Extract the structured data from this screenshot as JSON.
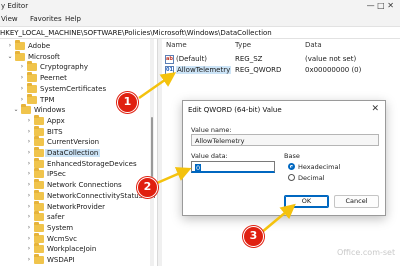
{
  "window": {
    "title": "y Editor",
    "controls": "—  □  ✕"
  },
  "menu": {
    "items": [
      "View",
      "Favorites",
      "Help"
    ]
  },
  "address": {
    "path": "HKEY_LOCAL_MACHINE\\SOFTWARE\\Policies\\Microsoft\\Windows\\DataCollection"
  },
  "tree": {
    "items": [
      {
        "label": "Adobe",
        "expanded": false,
        "selected": false
      },
      {
        "label": "Microsoft",
        "expanded": true,
        "selected": false
      },
      {
        "label": "Cryptography",
        "expanded": false,
        "selected": false
      },
      {
        "label": "Peernet",
        "expanded": false,
        "selected": false
      },
      {
        "label": "SystemCertificates",
        "expanded": false,
        "selected": false
      },
      {
        "label": "TPM",
        "expanded": false,
        "selected": false
      },
      {
        "label": "Windows",
        "expanded": true,
        "selected": false
      },
      {
        "label": "Appx",
        "expanded": false,
        "selected": false
      },
      {
        "label": "BITS",
        "expanded": false,
        "selected": false
      },
      {
        "label": "CurrentVersion",
        "expanded": false,
        "selected": false
      },
      {
        "label": "DataCollection",
        "expanded": false,
        "selected": true
      },
      {
        "label": "EnhancedStorageDevices",
        "expanded": false,
        "selected": false
      },
      {
        "label": "IPSec",
        "expanded": false,
        "selected": false
      },
      {
        "label": "Network Connections",
        "expanded": false,
        "selected": false
      },
      {
        "label": "NetworkConnectivityStatusIndi",
        "expanded": false,
        "selected": false
      },
      {
        "label": "NetworkProvider",
        "expanded": false,
        "selected": false
      },
      {
        "label": "safer",
        "expanded": false,
        "selected": false
      },
      {
        "label": "System",
        "expanded": false,
        "selected": false
      },
      {
        "label": "WcmSvc",
        "expanded": false,
        "selected": false
      },
      {
        "label": "WorkplaceJoin",
        "expanded": false,
        "selected": false
      },
      {
        "label": "WSDAPI",
        "expanded": false,
        "selected": false
      }
    ]
  },
  "values": {
    "headers": {
      "name": "Name",
      "type": "Type",
      "data": "Data"
    },
    "rows": [
      {
        "icon": "string-value-icon",
        "icon_text": "ab",
        "name": "(Default)",
        "type": "REG_SZ",
        "data": "(value not set)"
      },
      {
        "icon": "binary-value-icon",
        "icon_text": "01",
        "name": "AllowTelemetry",
        "type": "REG_QWORD",
        "data": "0x00000000 (0)"
      }
    ]
  },
  "dialog": {
    "title": "Edit QWORD (64-bit) Value",
    "close": "✕",
    "value_name_label": "Value name:",
    "value_name": "AllowTelemetry",
    "value_data_label": "Value data:",
    "value_data": "0",
    "base_label": "Base",
    "hex_label": "Hexadecimal",
    "dec_label": "Decimal",
    "ok_label": "OK",
    "cancel_label": "Cancel"
  },
  "annotations": {
    "step1": "1",
    "step2": "2",
    "step3": "3"
  },
  "watermark": "Office.com-set",
  "colors": {
    "badge": "#e02010",
    "arrow": "#f4c20d",
    "accent": "#0067c0",
    "selection": "#cce4f7",
    "folder": "#f0c44c"
  }
}
